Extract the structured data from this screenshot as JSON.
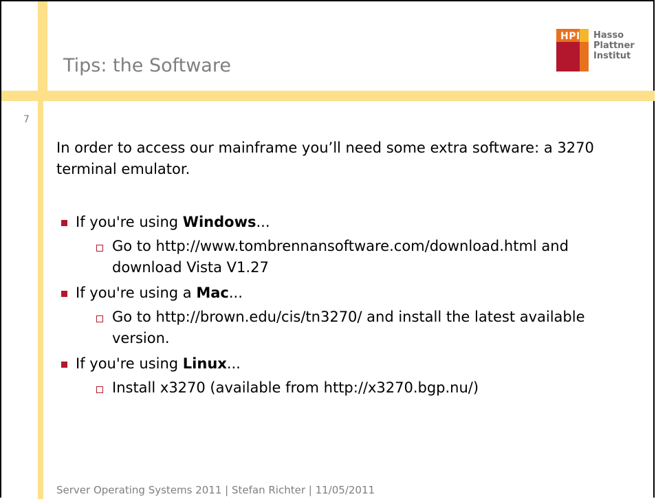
{
  "slide": {
    "title": "Tips: the Software",
    "number": "7",
    "logo": {
      "mark_text": "HPI",
      "lines": [
        "Hasso",
        "Plattner",
        "Institut"
      ]
    },
    "intro": "In order to access our mainframe you’ll need some extra software: a 3270 terminal emulator.",
    "bullets": [
      {
        "prefix": "If you're using ",
        "bold": "Windows",
        "suffix": "...",
        "sub": "Go to http://www.tombrennansoftware.com/download.html and download Vista V1.27"
      },
      {
        "prefix": "If you're using a ",
        "bold": "Mac",
        "suffix": "...",
        "sub": "Go to http://brown.edu/cis/tn3270/ and install the latest available version."
      },
      {
        "prefix": "If you're using ",
        "bold": "Linux",
        "suffix": "...",
        "sub": "Install x3270 (available from http://x3270.bgp.nu/)"
      }
    ],
    "footer": "Server Operating Systems 2011 | Stefan Richter | 11/05/2011"
  },
  "colors": {
    "accent_yellow": "#fde089",
    "bullet_red": "#b2172e",
    "logo_orange": "#e8711e",
    "logo_yellow": "#f6b52b",
    "gray_text": "#7f7f7f"
  }
}
